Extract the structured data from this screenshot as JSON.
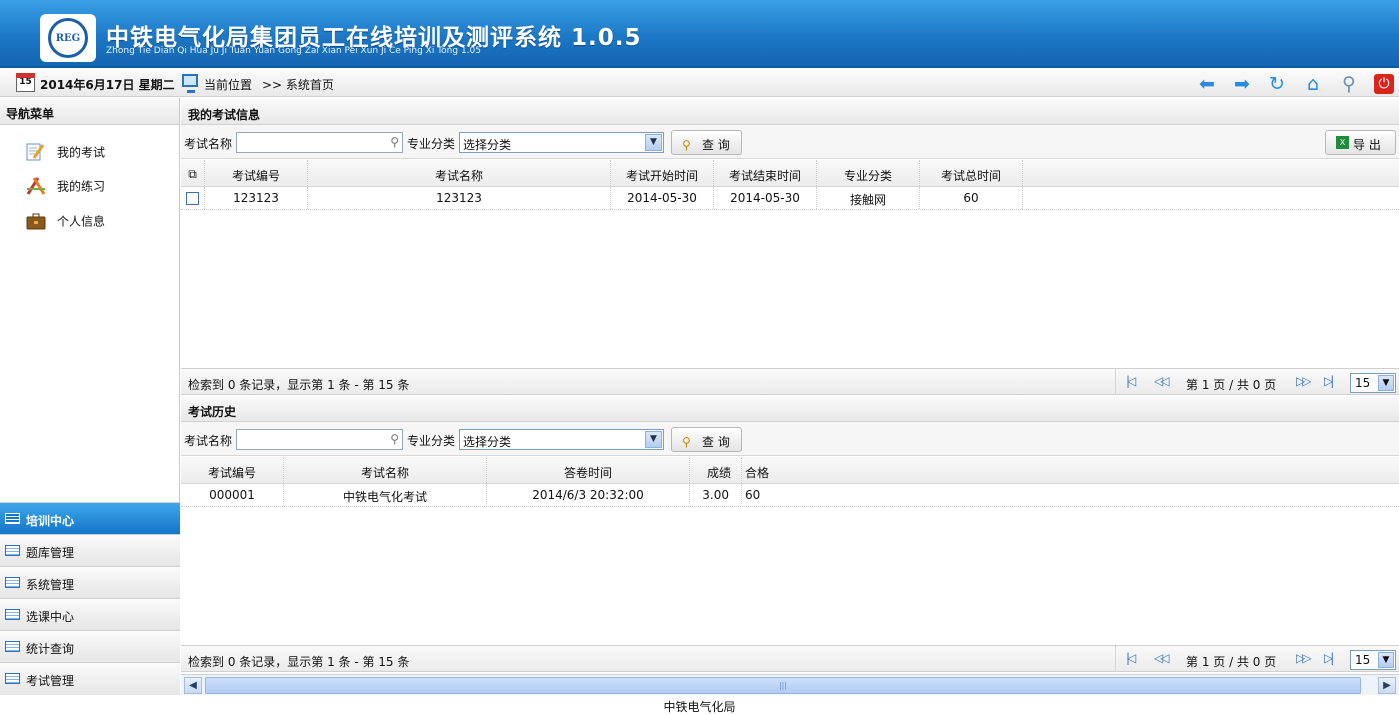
{
  "header": {
    "title": "中铁电气化局集团员工在线培训及测评系统 1.0.5",
    "subtitle": "Zhong Tie Dian Qi Hua Ju Ji Tuan Yuan Gong Zai Xian Pei Xun Ji Ce Ping Xi Tong 1.05",
    "logo_text": "REG"
  },
  "toolbar": {
    "calendar_day": "15",
    "date": "2014年6月17日 星期二",
    "position_label": "当前位置",
    "breadcrumb": ">> 系统首页",
    "icons": [
      "back-arrow-icon",
      "forward-arrow-icon",
      "refresh-icon",
      "home-icon",
      "search-icon",
      "power-icon"
    ]
  },
  "sidebar": {
    "title": "导航菜单",
    "items": [
      {
        "label": "我的考试",
        "icon": "notepad-pencil-icon"
      },
      {
        "label": "我的练习",
        "icon": "drafting-tools-icon"
      },
      {
        "label": "个人信息",
        "icon": "briefcase-icon"
      }
    ],
    "accordion": [
      {
        "label": "培训中心",
        "active": true
      },
      {
        "label": "题库管理",
        "active": false
      },
      {
        "label": "系统管理",
        "active": false
      },
      {
        "label": "选课中心",
        "active": false
      },
      {
        "label": "统计查询",
        "active": false
      },
      {
        "label": "考试管理",
        "active": false
      }
    ]
  },
  "exam_info": {
    "title": "我的考试信息",
    "filter": {
      "name_label": "考试名称",
      "name_value": "",
      "category_label": "专业分类",
      "category_value": "选择分类",
      "query_label": "查 询",
      "export_label": "导 出"
    },
    "columns": [
      "考试编号",
      "考试名称",
      "考试开始时间",
      "考试结束时间",
      "专业分类",
      "考试总时间"
    ],
    "rows": [
      {
        "id": "123123",
        "name": "123123",
        "start": "2014-05-30",
        "end": "2014-05-30",
        "category": "接触网",
        "duration": "60"
      }
    ],
    "pager": {
      "info": "检索到 0 条记录，显示第 1 条 - 第 15 条",
      "page_text": "第 1 页 / 共 0 页",
      "page_size": "15"
    }
  },
  "exam_history": {
    "title": "考试历史",
    "filter": {
      "name_label": "考试名称",
      "name_value": "",
      "category_label": "专业分类",
      "category_value": "选择分类",
      "query_label": "查 询"
    },
    "columns": [
      "考试编号",
      "考试名称",
      "答卷时间",
      "成绩",
      "合格"
    ],
    "rows": [
      {
        "id": "000001",
        "name": "中铁电气化考试",
        "time": "2014/6/3 20:32:00",
        "score": "3.00",
        "pass": "60"
      }
    ],
    "pager": {
      "info": "检索到 0 条记录，显示第 1 条 - 第 15 条",
      "page_text": "第 1 页 / 共 0 页",
      "page_size": "15"
    }
  },
  "footer": {
    "text": "中铁电气化局"
  },
  "colors": {
    "header_blue": "#1a75c4",
    "active_nav": "#1576c9",
    "icon_blue": "#2a8ce0",
    "power_red": "#d9261c"
  }
}
